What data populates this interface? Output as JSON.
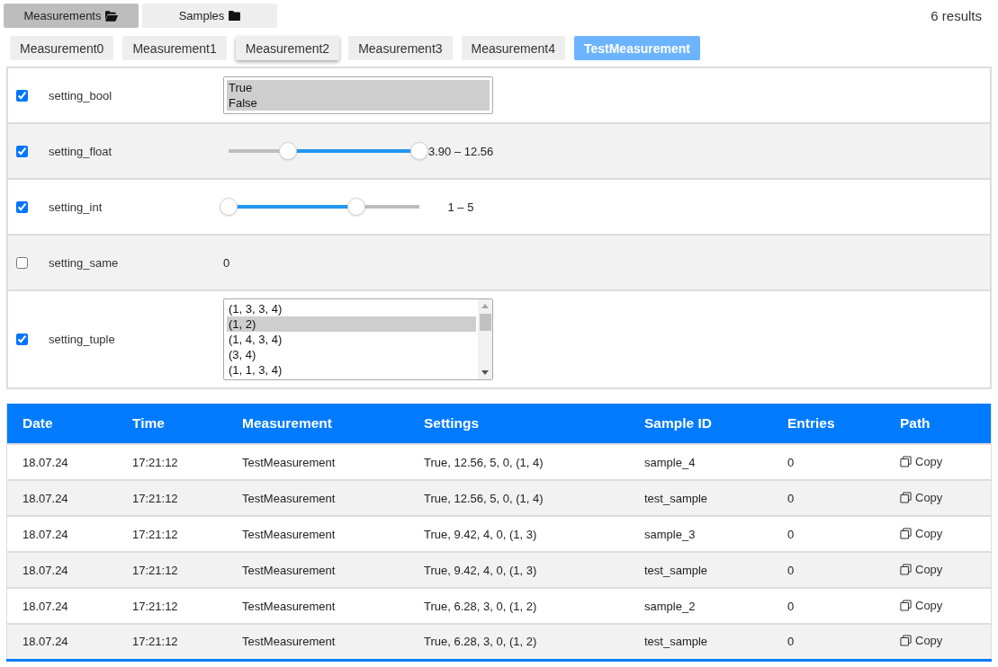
{
  "view_tabs": [
    {
      "label": "Measurements",
      "folder_open": true,
      "selected": true
    },
    {
      "label": "Samples",
      "folder_open": false,
      "selected": false
    }
  ],
  "result_count": "6 results",
  "measurement_tabs": [
    {
      "label": "Measurement0",
      "selected": false,
      "hovered": false
    },
    {
      "label": "Measurement1",
      "selected": false,
      "hovered": false
    },
    {
      "label": "Measurement2",
      "selected": false,
      "hovered": true
    },
    {
      "label": "Measurement3",
      "selected": false,
      "hovered": false
    },
    {
      "label": "Measurement4",
      "selected": false,
      "hovered": false
    },
    {
      "label": "TestMeasurement",
      "selected": true,
      "hovered": false
    }
  ],
  "settings": [
    {
      "kind": "listbox",
      "name": "setting_bool",
      "checked": true,
      "scrollable": false,
      "options": [
        {
          "label": "True",
          "selected": true
        },
        {
          "label": "False",
          "selected": true
        }
      ]
    },
    {
      "kind": "range",
      "name": "setting_float",
      "checked": true,
      "thumbs": [
        {
          "level": 0.31
        },
        {
          "level": 1
        }
      ],
      "reading": "3.90 – 12.56"
    },
    {
      "kind": "range",
      "name": "setting_int",
      "checked": true,
      "thumbs": [
        {
          "level": 0
        },
        {
          "level": 0.67
        }
      ],
      "reading": "1 – 5"
    },
    {
      "kind": "value",
      "name": "setting_same",
      "checked": false,
      "value": "0"
    },
    {
      "kind": "listbox",
      "name": "setting_tuple",
      "checked": true,
      "scrollable": true,
      "options": [
        {
          "label": "(1, 3, 3, 4)",
          "selected": false
        },
        {
          "label": "(1, 2)",
          "selected": true
        },
        {
          "label": "(1, 4, 3, 4)",
          "selected": false
        },
        {
          "label": "(3, 4)",
          "selected": false
        },
        {
          "label": "(1, 1, 3, 4)",
          "selected": false
        }
      ]
    }
  ],
  "table": {
    "columns": [
      "Date",
      "Time",
      "Measurement",
      "Settings",
      "Sample ID",
      "Entries",
      "Path"
    ],
    "rows": [
      {
        "date": "18.07.24",
        "time": "17:21:12",
        "measurement": "TestMeasurement",
        "settings": "True, 12.56, 5, 0, (1, 4)",
        "sample_id": "sample_4",
        "entries": "0",
        "path": "Copy"
      },
      {
        "date": "18.07.24",
        "time": "17:21:12",
        "measurement": "TestMeasurement",
        "settings": "True, 12.56, 5, 0, (1, 4)",
        "sample_id": "test_sample",
        "entries": "0",
        "path": "Copy"
      },
      {
        "date": "18.07.24",
        "time": "17:21:12",
        "measurement": "TestMeasurement",
        "settings": "True, 9.42, 4, 0, (1, 3)",
        "sample_id": "sample_3",
        "entries": "0",
        "path": "Copy"
      },
      {
        "date": "18.07.24",
        "time": "17:21:12",
        "measurement": "TestMeasurement",
        "settings": "True, 9.42, 4, 0, (1, 3)",
        "sample_id": "test_sample",
        "entries": "0",
        "path": "Copy"
      },
      {
        "date": "18.07.24",
        "time": "17:21:12",
        "measurement": "TestMeasurement",
        "settings": "True, 6.28, 3, 0, (1, 2)",
        "sample_id": "sample_2",
        "entries": "0",
        "path": "Copy"
      },
      {
        "date": "18.07.24",
        "time": "17:21:12",
        "measurement": "TestMeasurement",
        "settings": "True, 6.28, 3, 0, (1, 2)",
        "sample_id": "test_sample",
        "entries": "0",
        "path": "Copy"
      }
    ]
  }
}
